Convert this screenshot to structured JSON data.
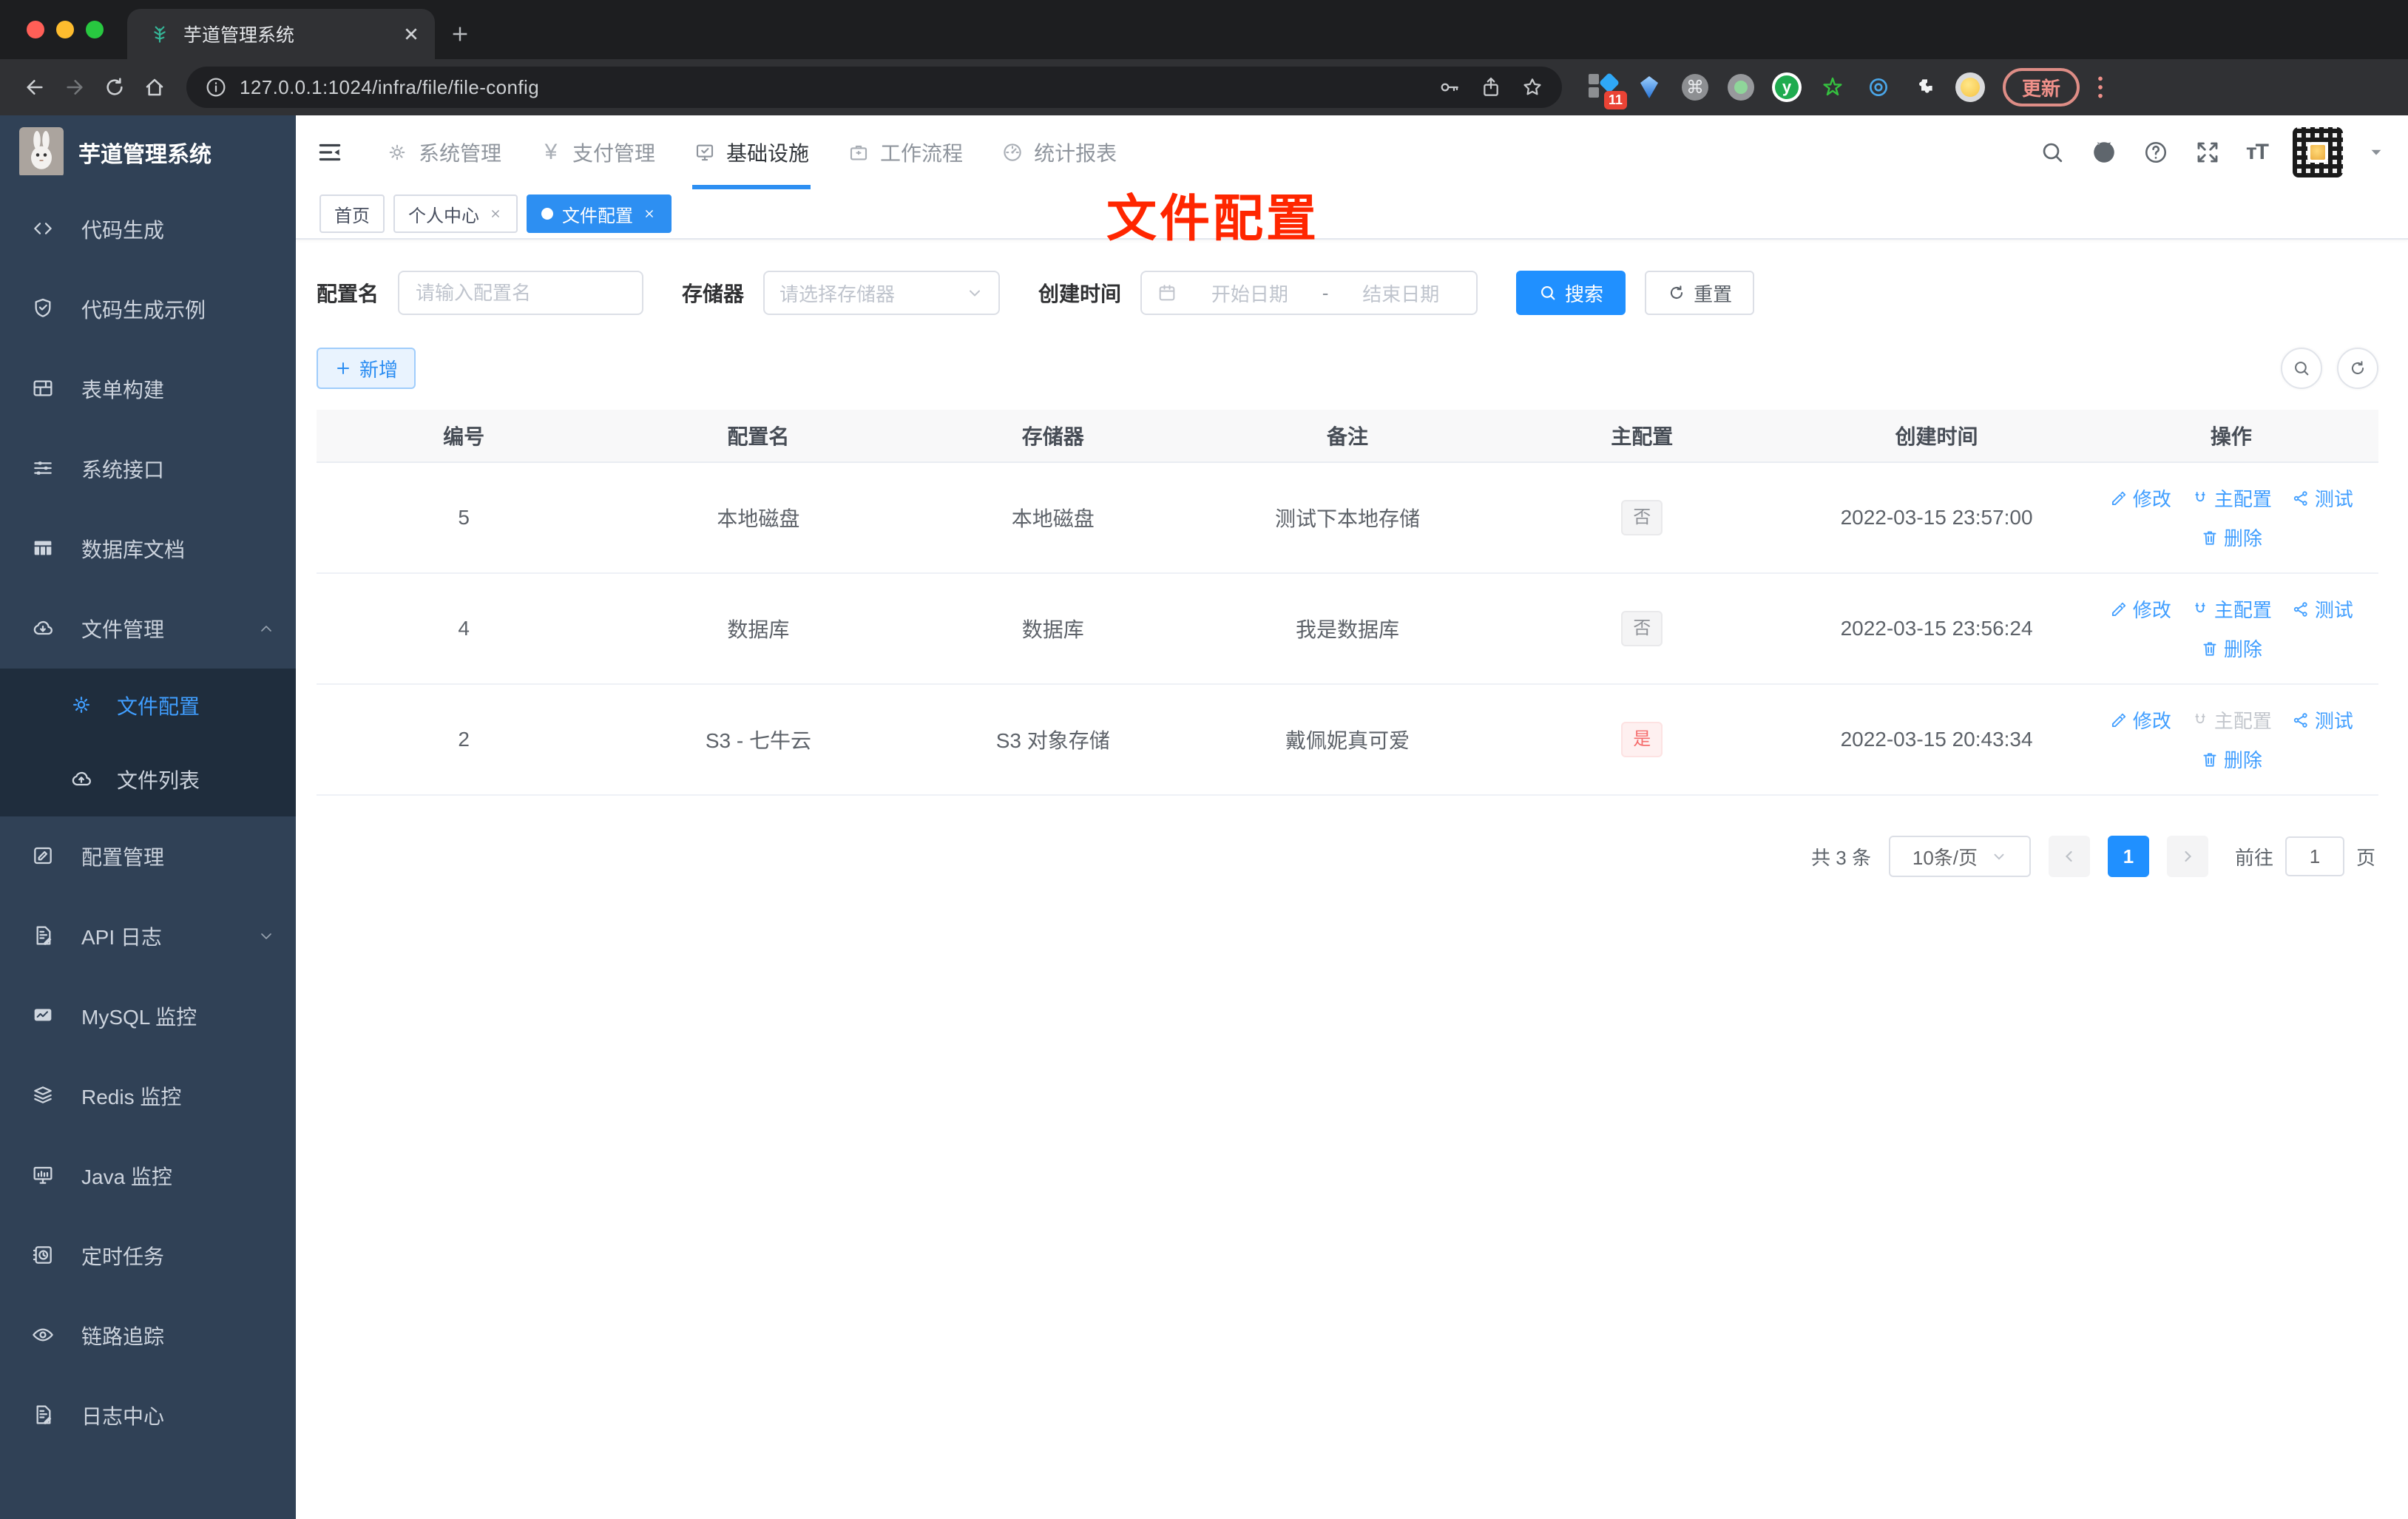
{
  "colors": {
    "accent_link": "#409eff",
    "primary_button": "#2090ff",
    "sidebar_bg": "#304156",
    "submenu_bg": "#1f2d3d",
    "tag_info_text": "#909399",
    "tag_danger_text": "#f56c6c",
    "annotation_red": "#ff2600",
    "chrome_dark": "#1d1e20"
  },
  "browser": {
    "tab_title": "芋道管理系统",
    "url": "127.0.0.1:1024/infra/file/file-config",
    "extensions_badge": "11",
    "ext_y_label": "y",
    "cmd_glyph": "⌘",
    "update_label": "更新"
  },
  "sidebar": {
    "logo_title": "芋道管理系统",
    "items": [
      {
        "icon": "code",
        "label": "代码生成"
      },
      {
        "icon": "shield",
        "label": "代码生成示例"
      },
      {
        "icon": "form",
        "label": "表单构建"
      },
      {
        "icon": "sliders",
        "label": "系统接口"
      },
      {
        "icon": "dbtable",
        "label": "数据库文档"
      },
      {
        "icon": "cloud-down",
        "label": "文件管理",
        "expanded": true,
        "children": [
          {
            "icon": "gear",
            "label": "文件配置",
            "active": true
          },
          {
            "icon": "cloud-up",
            "label": "文件列表"
          }
        ]
      },
      {
        "icon": "edit",
        "label": "配置管理"
      },
      {
        "icon": "doc-edit",
        "label": "API 日志",
        "collapsible": true
      },
      {
        "icon": "monitor-chart",
        "label": "MySQL 监控"
      },
      {
        "icon": "layers",
        "label": "Redis 监控"
      },
      {
        "icon": "desktop",
        "label": "Java 监控"
      },
      {
        "icon": "cron",
        "label": "定时任务"
      },
      {
        "icon": "eye",
        "label": "链路追踪"
      },
      {
        "icon": "doc-edit",
        "label": "日志中心"
      }
    ]
  },
  "topnav": {
    "items": [
      {
        "icon": "gear",
        "label": "系统管理"
      },
      {
        "icon": "yen",
        "label": "支付管理"
      },
      {
        "icon": "monitor-check",
        "label": "基础设施",
        "active": true
      },
      {
        "icon": "briefcase",
        "label": "工作流程"
      },
      {
        "icon": "dashboard",
        "label": "统计报表"
      }
    ]
  },
  "tags": [
    {
      "label": "首页"
    },
    {
      "label": "个人中心",
      "closable": true
    },
    {
      "label": "文件配置",
      "closable": true,
      "active": true
    }
  ],
  "annotation": "文件配置",
  "filter": {
    "name_label": "配置名",
    "name_placeholder": "请输入配置名",
    "storage_label": "存储器",
    "storage_placeholder": "请选择存储器",
    "date_label": "创建时间",
    "date_start": "开始日期",
    "date_separator": "-",
    "date_end": "结束日期",
    "search_label": "搜索",
    "reset_label": "重置"
  },
  "actions_bar": {
    "add_label": "新增"
  },
  "table": {
    "headers": [
      "编号",
      "配置名",
      "存储器",
      "备注",
      "主配置",
      "创建时间",
      "操作"
    ],
    "rows": [
      {
        "id": "5",
        "name": "本地磁盘",
        "storage": "本地磁盘",
        "remark": "测试下本地存储",
        "master": "否",
        "master_type": "info",
        "created": "2022-03-15 23:57:00",
        "master_action_disabled": false
      },
      {
        "id": "4",
        "name": "数据库",
        "storage": "数据库",
        "remark": "我是数据库",
        "master": "否",
        "master_type": "info",
        "created": "2022-03-15 23:56:24",
        "master_action_disabled": false
      },
      {
        "id": "2",
        "name": "S3 - 七牛云",
        "storage": "S3 对象存储",
        "remark": "戴佩妮真可爱",
        "master": "是",
        "master_type": "danger",
        "created": "2022-03-15 20:43:34",
        "master_action_disabled": true
      }
    ],
    "row_actions": {
      "edit": "修改",
      "master": "主配置",
      "test": "测试",
      "del": "删除"
    }
  },
  "pagination": {
    "total": "共 3 条",
    "page_size": "10条/页",
    "current_page": "1",
    "goto_label": "前往",
    "goto_value": "1",
    "page_unit": "页"
  }
}
